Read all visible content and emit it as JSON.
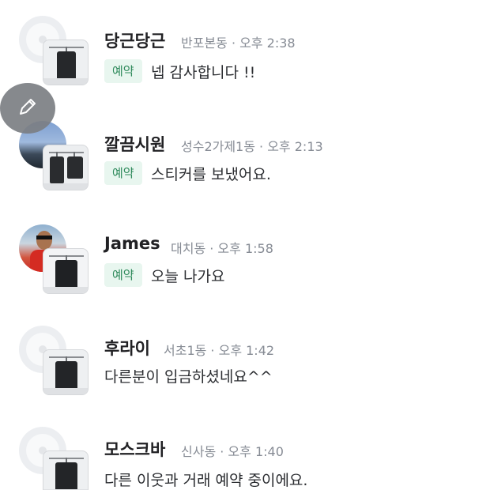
{
  "chats": [
    {
      "name": "당근당근",
      "location": "반포본동",
      "time": "오후 2:38",
      "meta": "반포본동 · 오후 2:38",
      "badge": "예약",
      "message": "넵 감사합니다 !!",
      "avatar_type": "default"
    },
    {
      "name": "깔끔시원",
      "location": "성수2가제1동",
      "time": "오후 2:13",
      "meta": "성수2가제1동 · 오후 2:13",
      "badge": "예약",
      "message": "스티커를 보냈어요.",
      "avatar_type": "photo-landscape"
    },
    {
      "name": "James",
      "location": "대치동",
      "time": "오후 1:58",
      "meta": "대치동 · 오후 1:58",
      "badge": "예약",
      "message": "오늘 나가요",
      "avatar_type": "photo-person"
    },
    {
      "name": "후라이",
      "location": "서초1동",
      "time": "오후 1:42",
      "meta": "서초1동 · 오후 1:42",
      "badge": "",
      "message": "다른분이 입금하셨네요^^",
      "avatar_type": "default"
    },
    {
      "name": "모스크바",
      "location": "신사동",
      "time": "오후 1:40",
      "meta": "신사동 · 오후 1:40",
      "badge": "",
      "message": "다른 이웃과 거래 예약 중이에요.",
      "avatar_type": "default"
    }
  ],
  "floating_button": {
    "icon": "pencil-icon"
  },
  "colors": {
    "badge_bg": "#e8f6ef",
    "badge_text": "#2e8a5b",
    "meta_text": "#868b94",
    "name_text": "#212124"
  }
}
